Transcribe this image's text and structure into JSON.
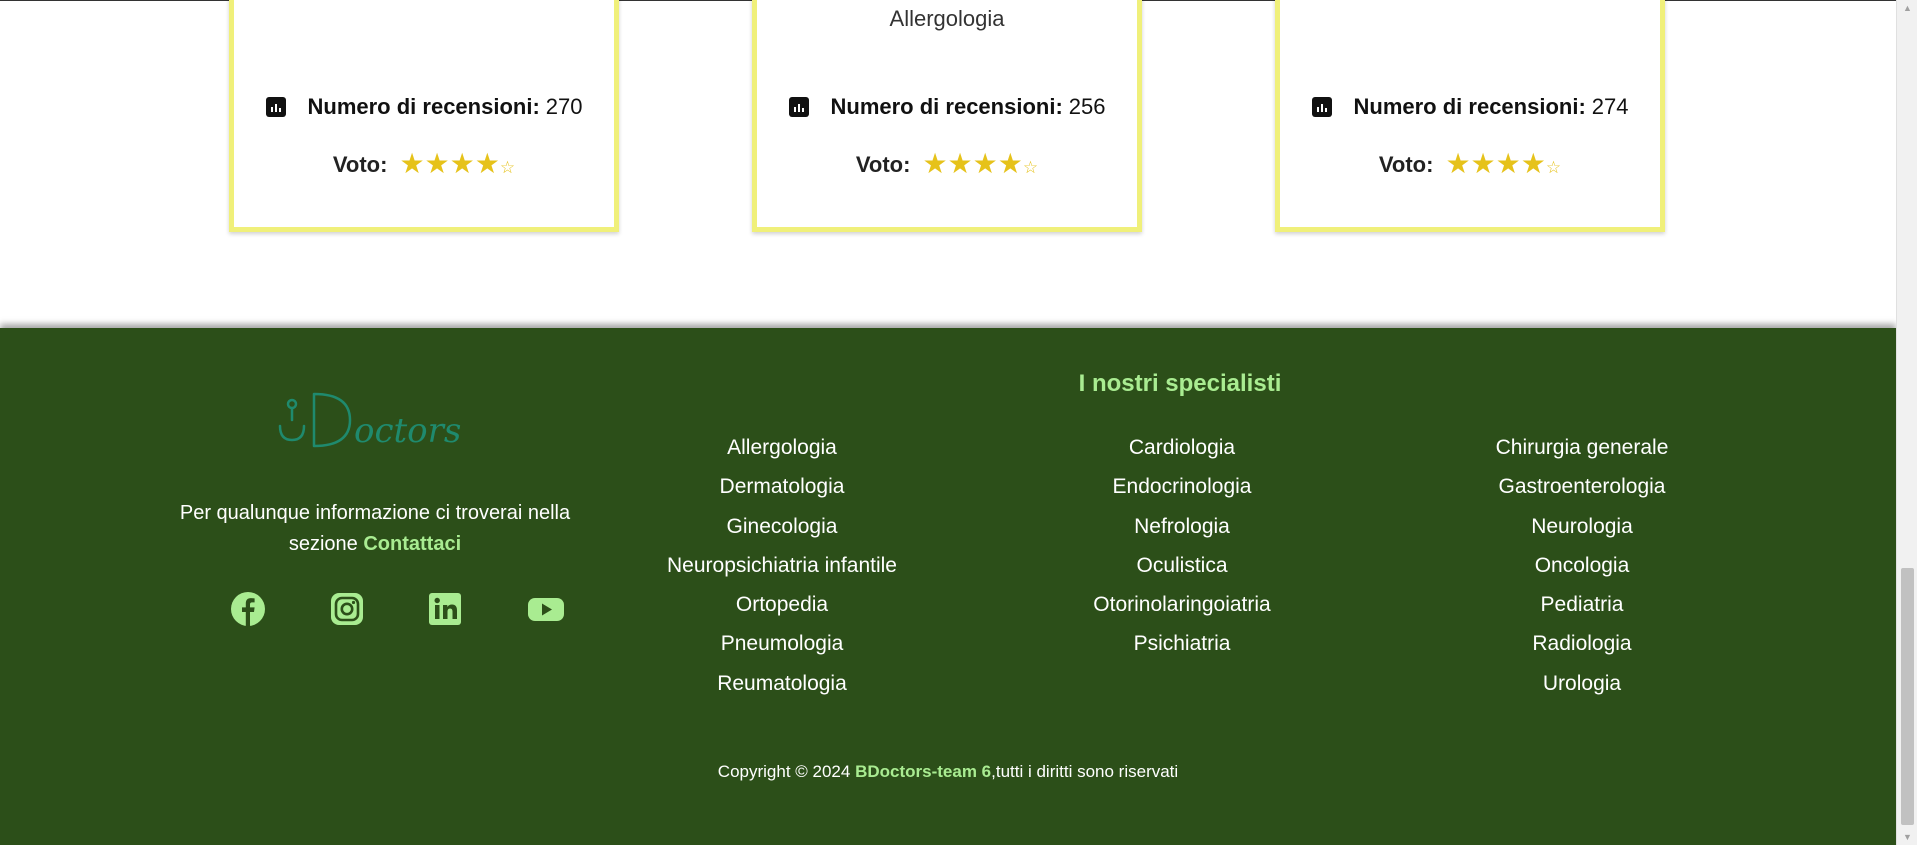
{
  "cards": [
    {
      "specialty": "",
      "reviews_label": "Numero di recensioni:",
      "reviews_count": "270",
      "vote_label": "Voto:",
      "rating": 4,
      "rating_max": 5
    },
    {
      "specialty": "Allergologia",
      "reviews_label": "Numero di recensioni:",
      "reviews_count": "256",
      "vote_label": "Voto:",
      "rating": 4,
      "rating_max": 5
    },
    {
      "specialty": "",
      "reviews_label": "Numero di recensioni:",
      "reviews_count": "274",
      "vote_label": "Voto:",
      "rating": 4,
      "rating_max": 5
    }
  ],
  "footer": {
    "logo_text": "BDoctors",
    "info_text": "Per qualunque informazione ci troverai nella sezione",
    "contact_link": "Contattaci",
    "socials": [
      "facebook-icon",
      "instagram-icon",
      "linkedin-icon",
      "youtube-icon"
    ],
    "specialists_title": "I nostri specialisti",
    "specialists_columns": [
      [
        "Allergologia",
        "Dermatologia",
        "Ginecologia",
        "Neuropsichiatria infantile",
        "Ortopedia",
        "Pneumologia",
        "Reumatologia"
      ],
      [
        "Cardiologia",
        "Endocrinologia",
        "Nefrologia",
        "Oculistica",
        "Otorinolaringoiatria",
        "Psichiatria"
      ],
      [
        "Chirurgia generale",
        "Gastroenterologia",
        "Neurologia",
        "Oncologia",
        "Pediatria",
        "Radiologia",
        "Urologia"
      ]
    ],
    "copyright_prefix": "Copyright © 2024",
    "copyright_team": "BDoctors-team 6",
    "copyright_suffix": ",tutti i diritti sono riservati"
  },
  "colors": {
    "footer_bg": "#2c4f19",
    "accent_green": "#a9ec91",
    "card_border": "#f0f07a",
    "star": "#e6c21a"
  }
}
